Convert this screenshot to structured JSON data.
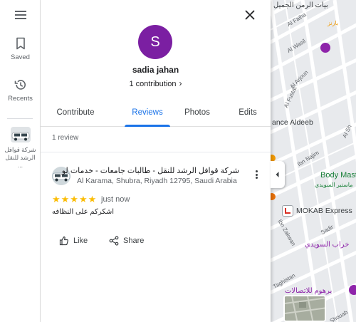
{
  "rail": {
    "menu_icon": "hamburger-menu-icon",
    "saved_label": "Saved",
    "recents_label": "Recents",
    "recent_place_label": "شركة قوافل\nالرشد للنقل ..."
  },
  "profile": {
    "avatar_letter": "S",
    "avatar_color": "#7b1fa2",
    "name": "sadia jahan",
    "contributions": "1 contribution"
  },
  "tabs": [
    {
      "label": "Contribute",
      "active": false
    },
    {
      "label": "Reviews",
      "active": true
    },
    {
      "label": "Photos",
      "active": false
    },
    {
      "label": "Edits",
      "active": false
    }
  ],
  "review_count": "1 review",
  "review": {
    "place_name": "شركة قوافل الرشد للنقل - طالبات جامعات - خدمات لوجستية",
    "place_address": "Al Karama, Shubra, Riyadh 12795, Saudi Arabia",
    "rating_stars": "★★★★★",
    "rating": 5,
    "date": "just now",
    "text": "اشكركم على النظافه",
    "like_label": "Like",
    "share_label": "Share"
  },
  "map": {
    "streets": [
      "Al Faiha",
      "Al Wasil",
      "Al Arjoun",
      "Al Fustat",
      "Ibn Najim",
      "Al Sh",
      "Ibn Zakwan",
      "Sadir",
      "Shouab",
      "Taghistan"
    ],
    "pois": {
      "top_partial": "بيات الرمن الجميل",
      "blue_partial": "بارنز",
      "ance_aldeeb": "ance Aldeeb",
      "body_mast": "Body Mast",
      "body_mast_ar": "ماستير السويدي",
      "mokab": "MOKAB Express",
      "kharab": "خراب السويدي",
      "barhoom": "برهوم للاتصالات"
    }
  },
  "colors": {
    "accent": "#1a73e8",
    "star": "#fbbc04",
    "map_bg": "#e8eaed"
  }
}
